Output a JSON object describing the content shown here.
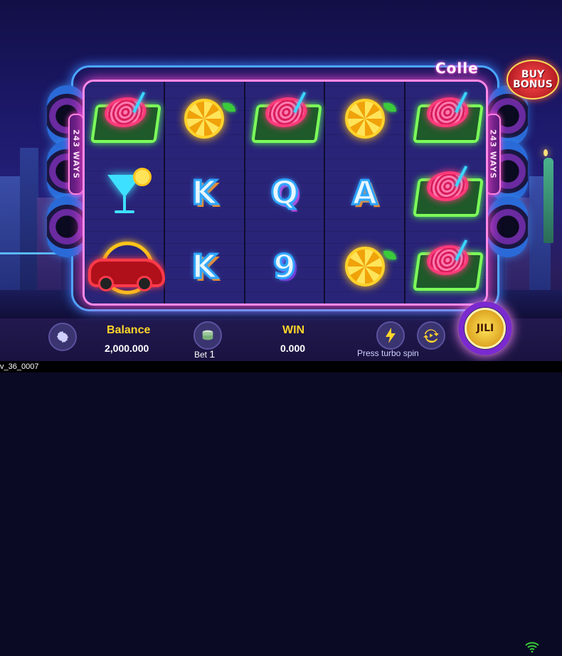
{
  "game": {
    "collect_sign": "Colle",
    "buy_bonus": {
      "line1": "BUY",
      "line2": "BONUS"
    },
    "ways_label": "243 WAYS",
    "spin_label": "JILI"
  },
  "reels": [
    [
      "turntable",
      "martini",
      "car"
    ],
    [
      "lemon",
      "K",
      "K"
    ],
    [
      "turntable",
      "Q",
      "9"
    ],
    [
      "lemon",
      "A",
      "lemon"
    ],
    [
      "turntable",
      "turntable",
      "turntable"
    ]
  ],
  "hud": {
    "balance_label": "Balance",
    "balance_value": "2,000.000",
    "bet_label": "Bet",
    "bet_value": "1",
    "win_label": "WIN",
    "win_value": "0.000",
    "turbo_hint": "Press turbo spin"
  },
  "footer": {
    "build_id": "v_36_0007"
  },
  "colors": {
    "accent_gold": "#ffd52a",
    "frame_pink": "#ff8ae6",
    "frame_blue": "#4aa8ff"
  }
}
